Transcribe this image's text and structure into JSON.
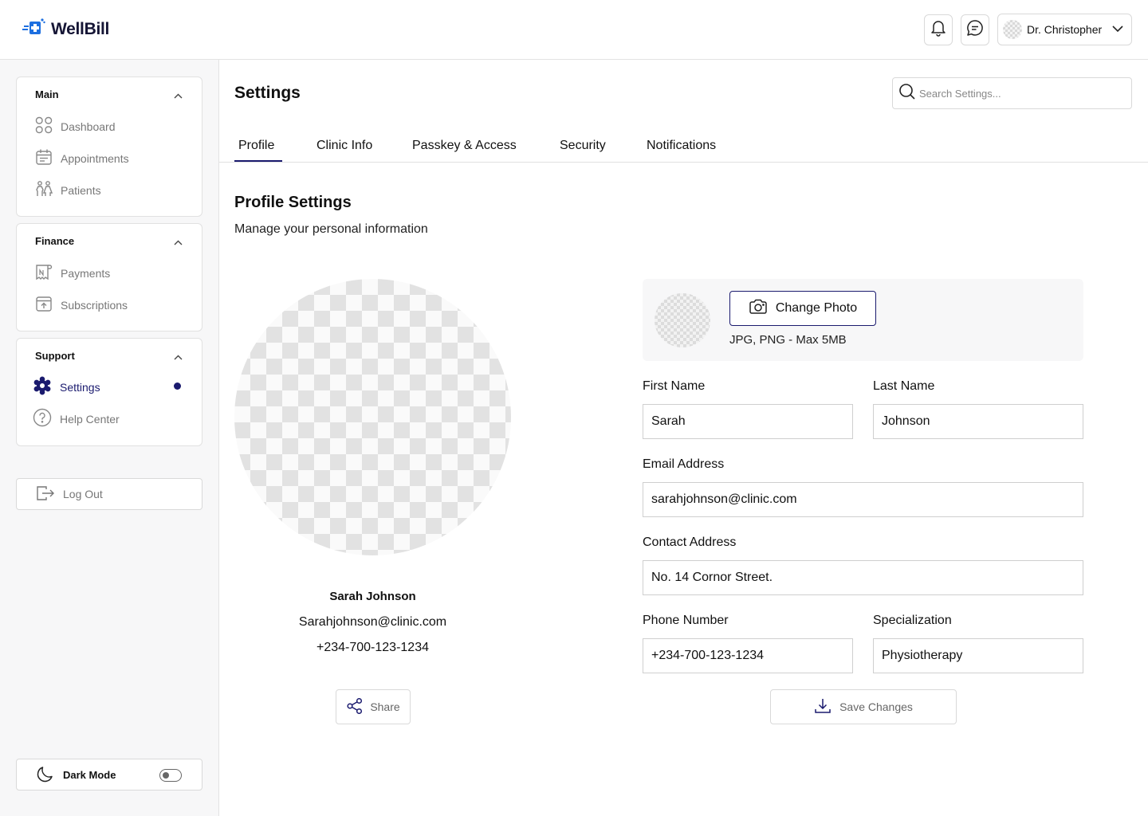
{
  "app": {
    "name": "WellBill"
  },
  "header": {
    "user_name": "Dr. Christopher"
  },
  "sidebar": {
    "sections": [
      {
        "title": "Main",
        "items": [
          {
            "label": "Dashboard"
          },
          {
            "label": "Appointments"
          },
          {
            "label": "Patients"
          }
        ]
      },
      {
        "title": "Finance",
        "items": [
          {
            "label": "Payments"
          },
          {
            "label": "Subscriptions"
          }
        ]
      },
      {
        "title": "Support",
        "items": [
          {
            "label": "Settings"
          },
          {
            "label": "Help Center"
          }
        ]
      }
    ],
    "logout_label": "Log Out",
    "dark_mode_label": "Dark Mode",
    "dark_mode_on": false
  },
  "page": {
    "title": "Settings",
    "search_placeholder": "Search Settings...",
    "tabs": [
      {
        "label": "Profile"
      },
      {
        "label": "Clinic Info"
      },
      {
        "label": "Passkey & Access"
      },
      {
        "label": "Security"
      },
      {
        "label": "Notifications"
      }
    ],
    "active_tab": "Profile"
  },
  "profile": {
    "section_title": "Profile Settings",
    "section_subtitle": "Manage your personal information",
    "card": {
      "name": "Sarah Johnson",
      "email": "Sarahjohnson@clinic.com",
      "phone": "+234-700-123-1234",
      "share_label": "Share"
    },
    "photo": {
      "change_label": "Change Photo",
      "hint": "JPG, PNG - Max 5MB"
    },
    "form": {
      "first_name": {
        "label": "First Name",
        "value": "Sarah"
      },
      "last_name": {
        "label": "Last Name",
        "value": "Johnson"
      },
      "email": {
        "label": "Email Address",
        "value": "sarahjohnson@clinic.com"
      },
      "address": {
        "label": "Contact Address",
        "value": "No. 14 Cornor Street."
      },
      "phone": {
        "label": "Phone Number",
        "value": "+234-700-123-1234"
      },
      "specialization": {
        "label": "Specialization",
        "value": "Physiotherapy"
      }
    },
    "save_label": "Save Changes"
  },
  "colors": {
    "accent": "#1a1a6e",
    "logo_blue": "#1d6fe0",
    "sidebar_bg": "#f7f7f8"
  }
}
